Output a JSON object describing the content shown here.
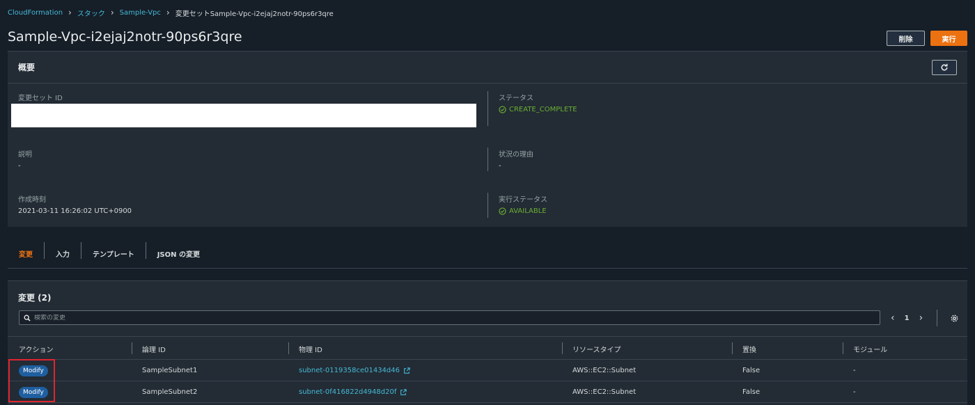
{
  "breadcrumb": {
    "items": [
      "CloudFormation",
      "スタック",
      "Sample-Vpc"
    ],
    "current": "変更セットSample-Vpc-i2ejaj2notr-90ps6r3qre"
  },
  "page_title": "Sample-Vpc-i2ejaj2notr-90ps6r3qre",
  "actions": {
    "delete_label": "削除",
    "execute_label": "実行"
  },
  "summary": {
    "title": "概要",
    "change_set_id_label": "変更セット ID",
    "status_label": "ステータス",
    "status_value": "CREATE_COMPLETE",
    "description_label": "説明",
    "description_value": "-",
    "status_reason_label": "状況の理由",
    "status_reason_value": "-",
    "created_label": "作成時刻",
    "created_value": "2021-03-11 16:26:02 UTC+0900",
    "exec_status_label": "実行ステータス",
    "exec_status_value": "AVAILABLE"
  },
  "tabs": [
    "変更",
    "入力",
    "テンプレート",
    "JSON の変更"
  ],
  "changes": {
    "title": "変更 (2)",
    "search_placeholder": "検索の変更",
    "page": "1",
    "columns": [
      "アクション",
      "論理 ID",
      "物理 ID",
      "リソースタイプ",
      "置換",
      "モジュール"
    ],
    "rows": [
      {
        "action": "Modify",
        "logical_id": "SampleSubnet1",
        "physical_id": "subnet-0119358ce01434d46",
        "resource_type": "AWS::EC2::Subnet",
        "replacement": "False",
        "module": "-"
      },
      {
        "action": "Modify",
        "logical_id": "SampleSubnet2",
        "physical_id": "subnet-0f416822d4948d20f",
        "resource_type": "AWS::EC2::Subnet",
        "replacement": "False",
        "module": "-"
      }
    ]
  },
  "colors": {
    "accent": "#ec7211",
    "link": "#44b9d6",
    "success": "#6aaf35",
    "badge": "#1f5fa0",
    "highlight": "#e0252f"
  }
}
